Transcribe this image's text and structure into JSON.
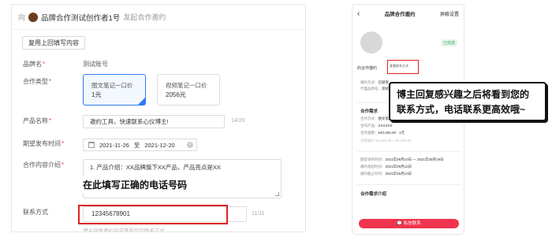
{
  "form": {
    "to_prefix": "向",
    "creator_name": "品牌合作测试创作者1号",
    "head_suffix": "发起合作邀约",
    "reuse_button": "复用上回填写内容",
    "brand_label": "品牌名",
    "brand_value": "测试账号",
    "type_label": "合作类型",
    "type_options": [
      {
        "name": "图文笔记一口价",
        "price": "1元",
        "selected": true
      },
      {
        "name": "视频笔记一口价",
        "price": "2056元",
        "selected": false
      }
    ],
    "product_label": "产品名称",
    "product_value": "邀约工具，快速联系心仪博主!",
    "product_counter": "14/20",
    "date_label": "期望发布时间",
    "date_start": "2021-11-26",
    "date_sep": "至",
    "date_end": "2021-12-20",
    "intro_label": "合作内容介绍",
    "intro_value": "1. 产品介绍：XX品牌旗下XX产品，产品亮点是XX",
    "callout_left": "在此填写正确的电话号码",
    "contact_label": "联系方式",
    "contact_value": "12345678901",
    "contact_counter": "11/11",
    "contact_hint": "博主回复邀约后可查看您的联系方式"
  },
  "phone": {
    "back": "‹",
    "title": "品牌合作邀约",
    "settings": "屏蔽设置",
    "tag": "已完成",
    "invite_label": "的合作邀约",
    "view_btn": "查看联系方式",
    "rows": [
      {
        "k": "邀约方式：",
        "v": "已接受"
      },
      {
        "k": "代理品牌名：",
        "v": "测试账号"
      }
    ],
    "req_title": "合作需求",
    "req_rows": [
      {
        "k": "合作方式：",
        "v": "图文笔记一口价"
      },
      {
        "k": "合作产品：",
        "v": "XXXXXX"
      },
      {
        "k": "合作金额：",
        "v": "¥40,000.00 · 1元"
      }
    ],
    "fee_note": "已经报价 ¥1,000.00 + ¥0,000.00",
    "date_rows": [
      {
        "k": "期望发布时间：",
        "v": "2021年09月10日 — 2021年09月19日"
      },
      {
        "k": "邀约发起时间：",
        "v": "2021年09月10日"
      },
      {
        "k": "邀约截止时间：",
        "v": "2021年09月10日"
      }
    ],
    "intro_title": "合作需求介绍",
    "cta": "私信联系"
  },
  "callout_right": {
    "line1": "博主回复感兴趣之后将看到您的",
    "line2": "联系方式，电话联系更高效哦~"
  },
  "colors": {
    "accent_blue": "#2d7bf6",
    "highlight_red": "#e02020",
    "cta_red": "#f0344e"
  }
}
